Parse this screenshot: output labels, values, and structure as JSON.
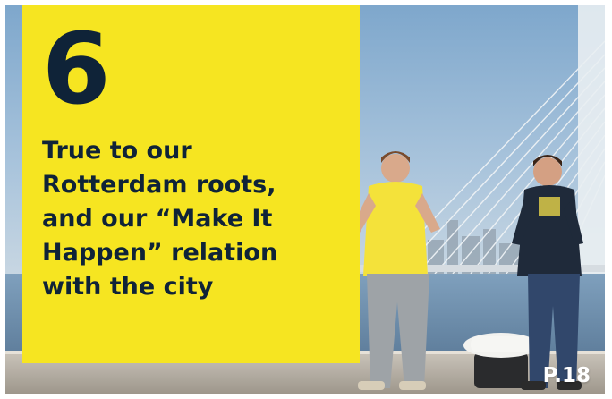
{
  "card": {
    "number": "6",
    "headline": "True to our Rotterdam roots, and our “Make It Happen” relation with the city",
    "page_ref": "P.18"
  },
  "colors": {
    "panel_yellow": "#f6e521",
    "text_navy": "#0f2338",
    "sky": "#8cb2d3",
    "water": "#6f8fad",
    "quay": "#b9b3aa"
  }
}
